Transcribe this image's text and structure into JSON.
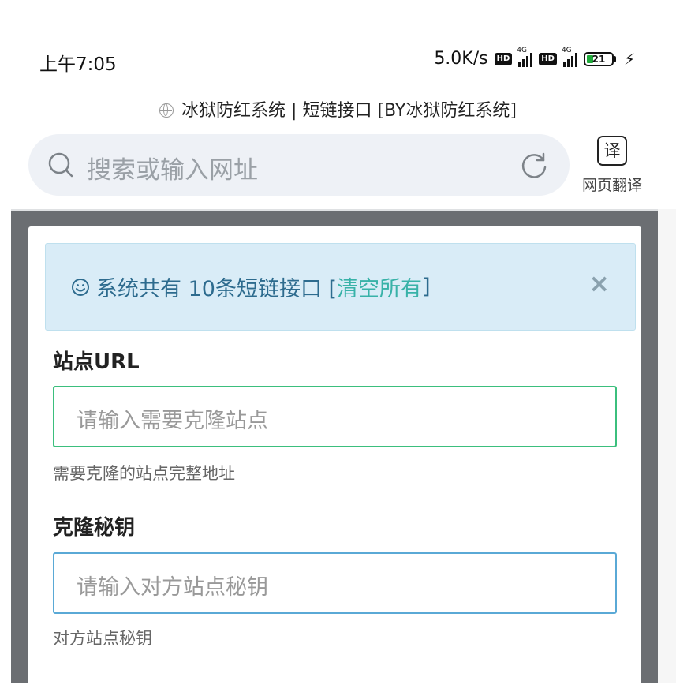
{
  "statusbar": {
    "time": "上午7:05",
    "speed": "5.0K/s",
    "hd_badge": "HD",
    "signal_label": "4G",
    "battery": "21"
  },
  "page": {
    "title": "冰狱防红系统 | 短链接口 [BY冰狱防红系统]"
  },
  "search": {
    "placeholder": "搜索或输入网址",
    "translate_icon_glyph": "译",
    "translate_label": "网页翻译"
  },
  "alert": {
    "text": "系统共有 10条短链接口 [",
    "link": "清空所有",
    "text_end": "]",
    "close": "×"
  },
  "form": {
    "site_url_label": "站点URL",
    "site_url_placeholder": "请输入需要克隆站点",
    "site_url_help": "需要克隆的站点完整地址",
    "key_label": "克隆秘钥",
    "key_placeholder": "请输入对方站点秘钥",
    "key_help": "对方站点秘钥"
  },
  "colors": {
    "alert_bg": "#d9ecf7",
    "alert_text": "#2d6b8e",
    "link": "#38b2a8",
    "field1_border": "#3bbf7d",
    "field2_border": "#5aa9d6"
  }
}
